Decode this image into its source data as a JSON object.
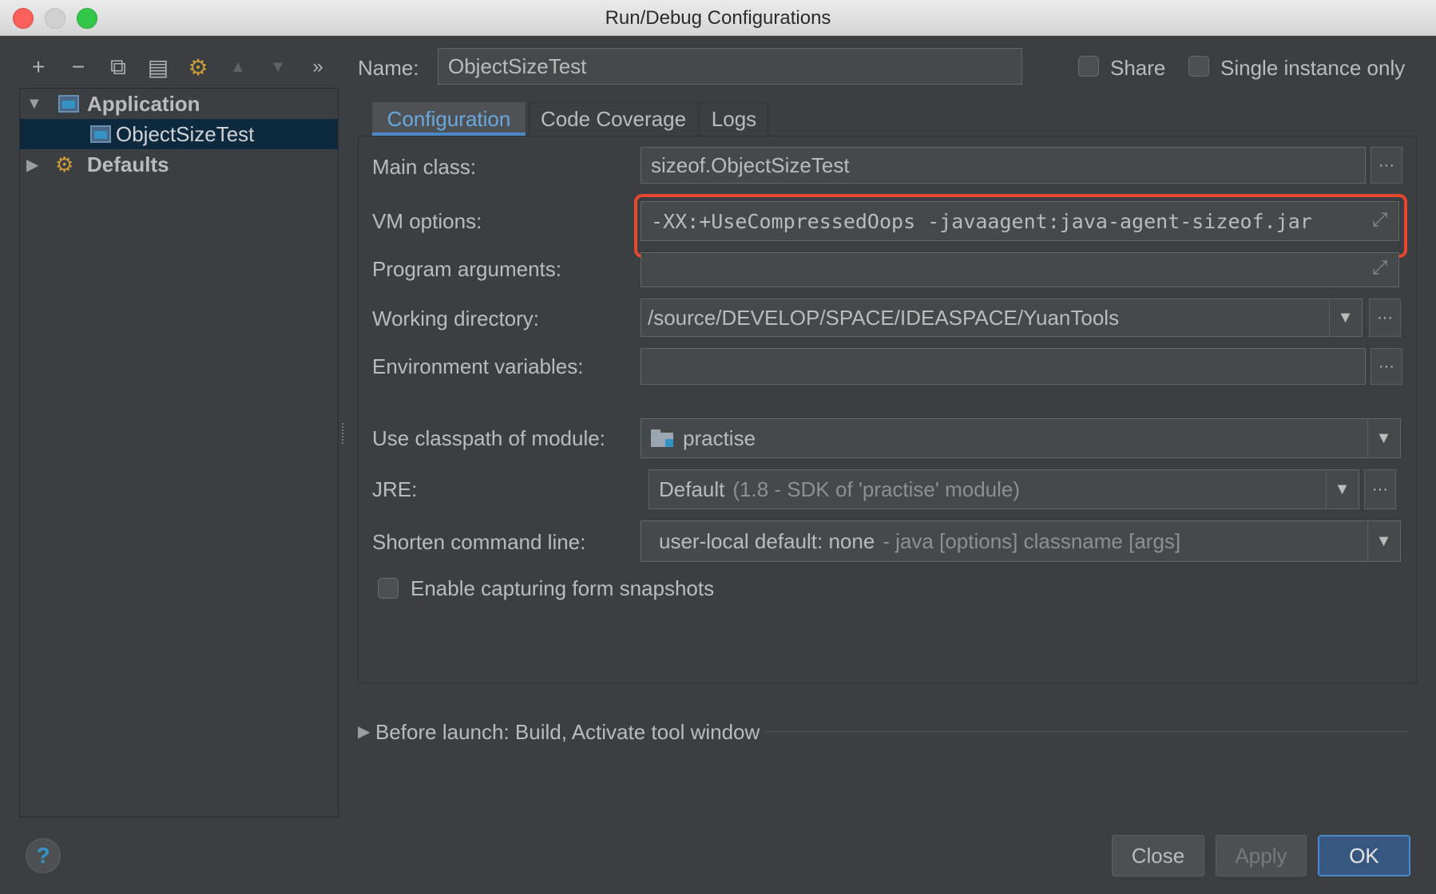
{
  "window": {
    "title": "Run/Debug Configurations"
  },
  "toolbar": {
    "icons": [
      "plus-icon",
      "minus-icon",
      "copy-icon",
      "save-icon",
      "edit-defaults-icon",
      "move-up-icon",
      "move-down-icon",
      "more-icon"
    ],
    "glyphs": [
      "+",
      "−",
      "⧉",
      "▤",
      "⚙",
      "▲",
      "▼",
      "»"
    ]
  },
  "tree": {
    "application": "Application",
    "child": "ObjectSizeTest",
    "defaults": "Defaults"
  },
  "header": {
    "name_label": "Name:",
    "name_value": "ObjectSizeTest",
    "share_label": "Share",
    "single_instance_label": "Single instance only"
  },
  "tabs": [
    "Configuration",
    "Code Coverage",
    "Logs"
  ],
  "form": {
    "main_class_label": "Main class:",
    "main_class_value": "sizeof.ObjectSizeTest",
    "vm_options_label": "VM options:",
    "vm_options_value": "-XX:+UseCompressedOops -javaagent:java-agent-sizeof.jar",
    "program_args_label": "Program arguments:",
    "program_args_value": "",
    "working_dir_label": "Working directory:",
    "working_dir_value": "/source/DEVELOP/SPACE/IDEASPACE/YuanTools",
    "env_vars_label": "Environment variables:",
    "env_vars_value": "",
    "classpath_label": "Use classpath of module:",
    "classpath_value": "practise",
    "jre_label": "JRE:",
    "jre_value": "Default",
    "jre_hint": "(1.8 - SDK of 'practise' module)",
    "shorten_label": "Shorten command line:",
    "shorten_value": "user-local default: none",
    "shorten_hint": "- java [options] classname [args]",
    "snapshots_label": "Enable capturing form snapshots"
  },
  "before_launch": "Before launch: Build, Activate tool window",
  "buttons": {
    "help": "?",
    "close": "Close",
    "apply": "Apply",
    "ok": "OK"
  },
  "colors": {
    "accent": "#4a88c7",
    "highlight_border": "#e5472f",
    "selection": "#0d293e"
  }
}
